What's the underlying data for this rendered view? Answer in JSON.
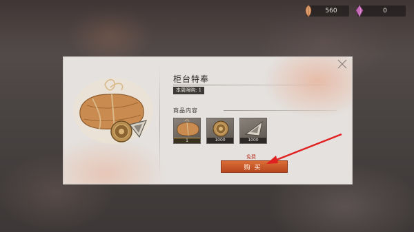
{
  "currencies": [
    {
      "icon": "feather-icon",
      "value": "560"
    },
    {
      "icon": "gem-icon",
      "value": "0"
    }
  ],
  "dialog": {
    "title": "柜台特奉",
    "limit_label": "本周限购: 1",
    "contents_label": "商品内容",
    "items": [
      {
        "icon": "bundle-icon",
        "quantity": "1"
      },
      {
        "icon": "coin-icon",
        "quantity": "1000"
      },
      {
        "icon": "prism-icon",
        "quantity": "1000"
      }
    ],
    "price_label": "免费",
    "buy_label": "购买",
    "close_icon": "close-icon"
  },
  "colors": {
    "accent": "#c9532a",
    "price": "#c0392b",
    "annotation_arrow": "#e02020"
  }
}
